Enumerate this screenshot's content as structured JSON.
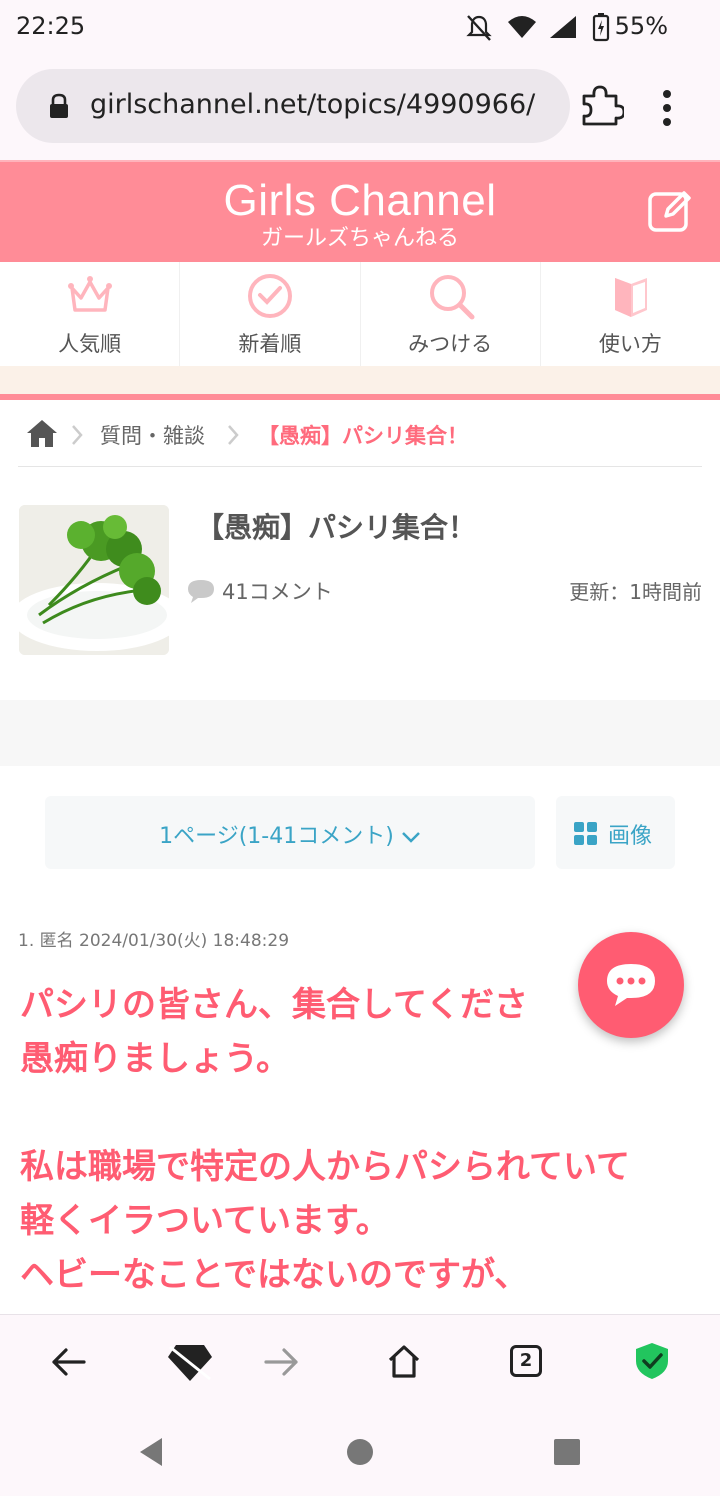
{
  "status_bar": {
    "time": "22:25",
    "battery": "55%"
  },
  "browser": {
    "url": "girlschannel.net/topics/4990966/",
    "tabs_count": "2"
  },
  "header": {
    "title": "Girls Channel",
    "subtitle": "ガールズちゃんねる"
  },
  "nav": [
    {
      "label": "人気順",
      "icon": "crown-icon"
    },
    {
      "label": "新着順",
      "icon": "clock-icon"
    },
    {
      "label": "みつける",
      "icon": "search-icon"
    },
    {
      "label": "使い方",
      "icon": "book-icon"
    }
  ],
  "breadcrumb": {
    "category": "質問・雑談",
    "current": "【愚痴】パシリ集合！"
  },
  "topic": {
    "title": "【愚痴】パシリ集合！",
    "comment_count": "41コメント",
    "updated": "更新：1時間前"
  },
  "pager": {
    "label": "1ページ(1-41コメント)",
    "image_label": "画像"
  },
  "comment": {
    "meta": "1. 匿名 2024/01/30(火) 18:48:29",
    "lines": [
      "パシリの皆さん、集合してくださ",
      "愚痴りましょう。",
      "",
      "私は職場で特定の人からパシられていて",
      "軽くイラついています。",
      "ヘビーなことではないのですが、"
    ]
  },
  "colors": {
    "brand": "#ff8c97",
    "accent": "#ff5c72",
    "link": "#3aa4c6"
  }
}
